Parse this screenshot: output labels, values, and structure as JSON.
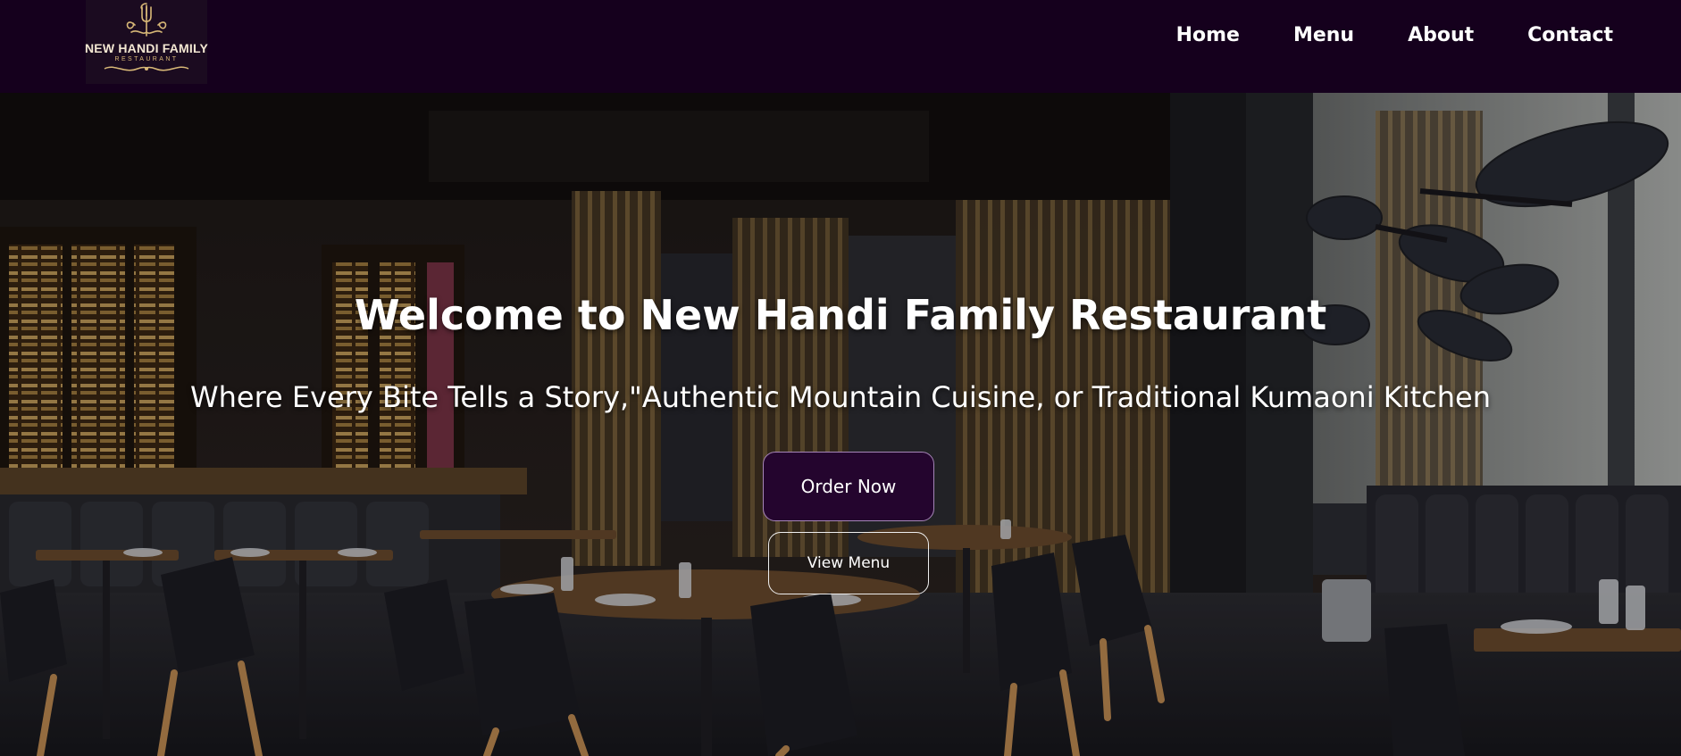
{
  "brand": {
    "name": "NEW HANDI FAMILY",
    "tagline": "RESTAURANT",
    "logo_icon": "fork-crest-icon",
    "gold": "#d8b877"
  },
  "nav": {
    "items": [
      {
        "label": "Home"
      },
      {
        "label": "Menu"
      },
      {
        "label": "About"
      },
      {
        "label": "Contact"
      }
    ]
  },
  "hero": {
    "title": "Welcome to New Handi Family Restaurant",
    "subtitle": "Where Every Bite Tells a Story,\"Authentic Mountain Cuisine, or Traditional Kumaoni Kitchen",
    "primary_button": "Order Now",
    "secondary_button": "View Menu",
    "accent": "#24052e"
  }
}
